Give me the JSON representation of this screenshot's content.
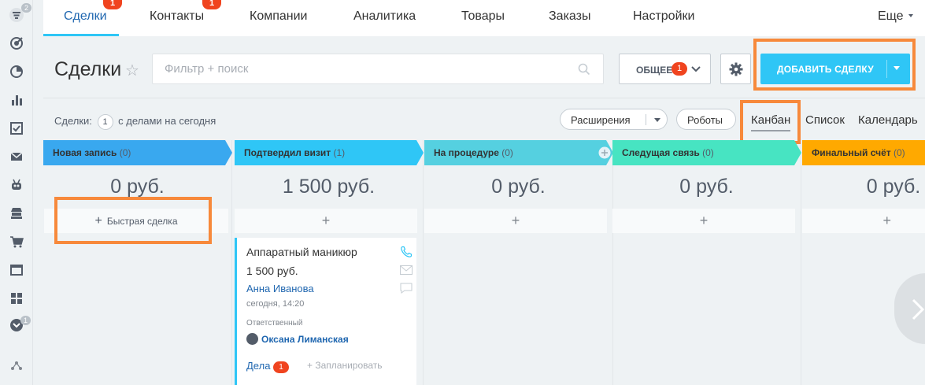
{
  "rail": {
    "top_badge": "2",
    "bottom_badge": "1",
    "icons": [
      "filter-icon",
      "target-icon",
      "clock-icon",
      "bar-chart-icon",
      "checklist-icon",
      "mail-icon",
      "robot-icon",
      "shop-icon",
      "cart-icon",
      "window-icon",
      "apps-icon",
      "chevron-down-icon",
      "sitemap-icon"
    ]
  },
  "topnav": {
    "items": [
      {
        "label": "Сделки",
        "badge": "1"
      },
      {
        "label": "Контакты",
        "badge": "1"
      },
      {
        "label": "Компании"
      },
      {
        "label": "Аналитика"
      },
      {
        "label": "Товары"
      },
      {
        "label": "Заказы"
      },
      {
        "label": "Настройки"
      }
    ],
    "more_label": "Еще"
  },
  "header": {
    "title": "Сделки",
    "search_placeholder": "Фильтр + поиск",
    "general_label": "ОБЩЕЕ",
    "general_badge": "1",
    "add_label": "ДОБАВИТЬ СДЕЛКУ"
  },
  "toolbar": {
    "counter_prefix": "Сделки:",
    "counter_value": "1",
    "counter_suffix": "с делами на сегодня",
    "extensions_label": "Расширения",
    "robots_label": "Роботы",
    "views": [
      "Канбан",
      "Список",
      "Календарь"
    ]
  },
  "columns": [
    {
      "title": "Новая запись",
      "count": "(0)",
      "sum": "0 руб.",
      "color": "#39a8ef"
    },
    {
      "title": "Подтвердил визит",
      "count": "(1)",
      "sum": "1 500 руб.",
      "color": "#2fc6f6"
    },
    {
      "title": "На процедуре",
      "count": "(0)",
      "sum": "0 руб.",
      "color": "#55d0e0"
    },
    {
      "title": "Следущая связь",
      "count": "(0)",
      "sum": "0 руб.",
      "color": "#47e4c2"
    },
    {
      "title": "Финальный счёт",
      "count": "(0)",
      "sum": "0 руб.",
      "color": "#ffa900"
    }
  ],
  "quick_deal": {
    "plus": "+",
    "label": "Быстрая сделка"
  },
  "col_add_plus": "+",
  "card": {
    "title": "Аппаратный маникюр",
    "price": "1 500 руб.",
    "contact": "Анна Иванова",
    "date": "сегодня, 14:20",
    "responsible_label": "Ответственный",
    "responsible": "Оксана Лиманская",
    "tasks_label": "Дела",
    "tasks_badge": "1",
    "plan_label": "+ Запланировать"
  }
}
